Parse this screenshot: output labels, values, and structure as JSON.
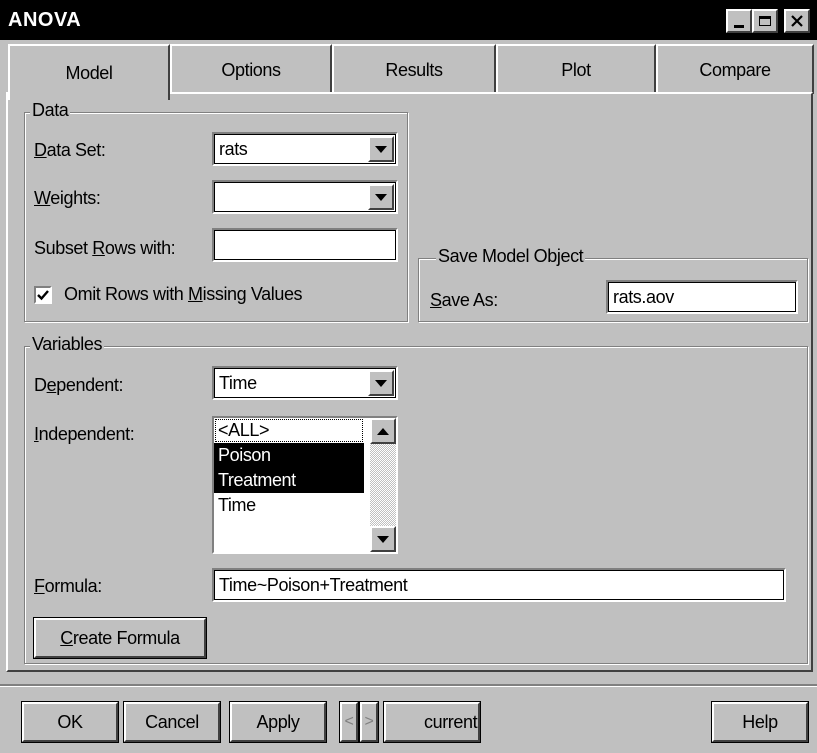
{
  "window": {
    "title": "ANOVA"
  },
  "tabs": [
    {
      "label": "Model",
      "active": true
    },
    {
      "label": "Options",
      "active": false
    },
    {
      "label": "Results",
      "active": false
    },
    {
      "label": "Plot",
      "active": false
    },
    {
      "label": "Compare",
      "active": false
    }
  ],
  "data_group": {
    "legend": "Data",
    "data_set_label": "Data Set:",
    "data_set_value": "rats",
    "weights_label": "Weights:",
    "weights_value": "",
    "subset_label": "Subset Rows with:",
    "subset_value": "",
    "omit_missing_label": "Omit Rows with Missing Values",
    "omit_missing_checked": true
  },
  "save_group": {
    "legend": "Save Model Object",
    "save_as_label": "Save As:",
    "save_as_value": "rats.aov"
  },
  "variables_group": {
    "legend": "Variables",
    "dependent_label": "Dependent:",
    "dependent_value": "Time",
    "independent_label": "Independent:",
    "independent_items": [
      {
        "label": "<ALL>",
        "selected": false,
        "focused": true
      },
      {
        "label": "Poison",
        "selected": true
      },
      {
        "label": "Treatment",
        "selected": true
      },
      {
        "label": "Time",
        "selected": false
      }
    ],
    "formula_label": "Formula:",
    "formula_value": "Time~Poison+Treatment",
    "create_formula_label": "Create Formula"
  },
  "footer": {
    "ok_label": "OK",
    "cancel_label": "Cancel",
    "apply_label": "Apply",
    "prev_symbol": "<",
    "next_symbol": ">",
    "current_label": "current",
    "help_label": "Help"
  },
  "colors": {
    "face": "#c0c0c0",
    "title_bar": "#000000",
    "selection": "#000000"
  }
}
